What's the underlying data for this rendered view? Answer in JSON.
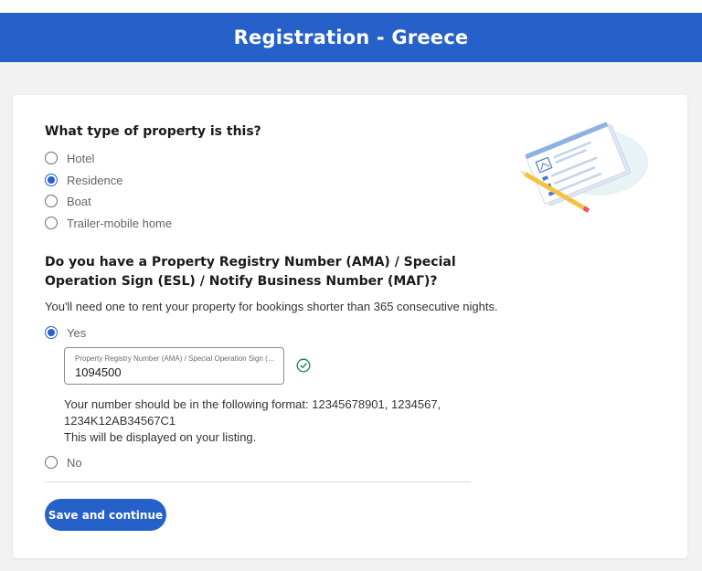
{
  "header": {
    "title": "Registration - Greece"
  },
  "property_type": {
    "question": "What type of property is this?",
    "options": [
      {
        "label": "Hotel",
        "selected": false
      },
      {
        "label": "Residence",
        "selected": true
      },
      {
        "label": "Boat",
        "selected": false
      },
      {
        "label": "Trailer-mobile home",
        "selected": false
      }
    ]
  },
  "registry": {
    "question": "Do you have a Property Registry Number (AMA) / Special Operation Sign (ESL) / Notify Business Number (ΜΑΓ)?",
    "helper": "You'll need one to rent your property for bookings shorter than 365 consecutive nights.",
    "yes_label": "Yes",
    "yes_selected": true,
    "no_label": "No",
    "no_selected": false,
    "input_label": "Property Registry Number (AMA) / Special Operation Sign (ESL) / Notify Business Number (ΜΑΓ)",
    "input_value": "1094500",
    "format_line1": "Your number should be in the following format: 12345678901, 1234567,",
    "format_line2": "1234K12AB34567C1",
    "display_note": "This will be displayed on your listing."
  },
  "actions": {
    "save_label": "Save and continue"
  },
  "colors": {
    "brand_blue": "#2561c9",
    "success_green": "#0b8a4a",
    "background": "#f2f2f2"
  }
}
